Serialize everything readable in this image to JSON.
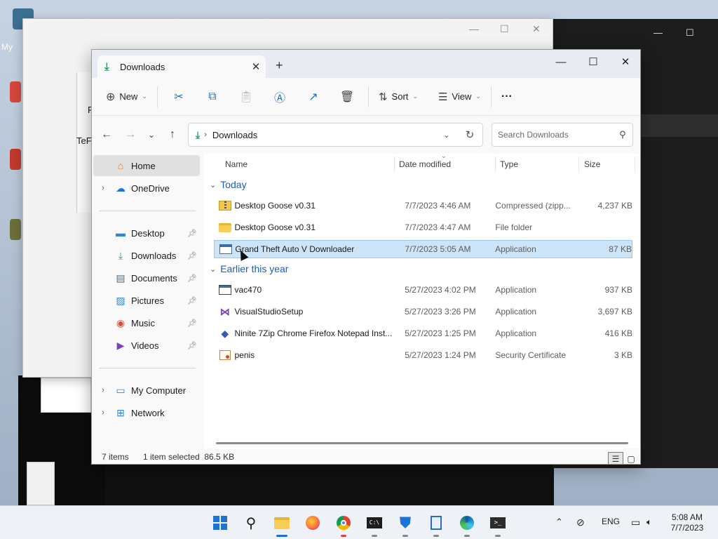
{
  "desktop": {
    "bg_window_controls": [
      "—",
      "☐",
      "✕"
    ],
    "dark_window_controls": [
      "—",
      "☐"
    ],
    "fragment_my": "My",
    "fragment_te": "TeF",
    "fragment_f": "F"
  },
  "explorer": {
    "tab_title": "Downloads",
    "tab_close": "✕",
    "new_tab": "+",
    "window_controls": {
      "minimize": "—",
      "maximize": "☐",
      "close": "✕"
    },
    "toolbar": {
      "new_label": "New",
      "sort_label": "Sort",
      "view_label": "View",
      "more": "···"
    },
    "address": {
      "path": "Downloads",
      "search_placeholder": "Search Downloads"
    },
    "sidebar": {
      "home": "Home",
      "onedrive": "OneDrive",
      "pinned": [
        "Desktop",
        "Downloads",
        "Documents",
        "Pictures",
        "Music",
        "Videos"
      ],
      "my_computer": "My Computer",
      "network": "Network"
    },
    "columns": {
      "name": "Name",
      "date": "Date modified",
      "type": "Type",
      "size": "Size"
    },
    "groups": {
      "today": "Today",
      "earlier": "Earlier this year"
    },
    "files_today": [
      {
        "name": "Desktop Goose v0.31",
        "date": "7/7/2023 4:46 AM",
        "type": "Compressed (zipp...",
        "size": "4,237 KB",
        "icon": "zip"
      },
      {
        "name": "Desktop Goose v0.31",
        "date": "7/7/2023 4:47 AM",
        "type": "File folder",
        "size": "",
        "icon": "folder"
      },
      {
        "name": "Grand Theft Auto V Downloader",
        "date": "7/7/2023 5:05 AM",
        "type": "Application",
        "size": "87 KB",
        "icon": "app",
        "selected": true
      }
    ],
    "files_earlier": [
      {
        "name": "vac470",
        "date": "5/27/2023 4:02 PM",
        "type": "Application",
        "size": "937 KB",
        "icon": "app"
      },
      {
        "name": "VisualStudioSetup",
        "date": "5/27/2023 3:26 PM",
        "type": "Application",
        "size": "3,697 KB",
        "icon": "vs"
      },
      {
        "name": "Ninite 7Zip Chrome Firefox Notepad Inst...",
        "date": "5/27/2023 1:25 PM",
        "type": "Application",
        "size": "416 KB",
        "icon": "ninite"
      },
      {
        "name": "penis",
        "date": "5/27/2023 1:24 PM",
        "type": "Security Certificate",
        "size": "3 KB",
        "icon": "cert"
      }
    ],
    "status": {
      "items": "7 items",
      "selected": "1 item selected  86.5 KB"
    }
  },
  "taskbar": {
    "tray_lang": "ENG",
    "time": "5:08 AM",
    "date": "7/7/2023"
  },
  "colors": {
    "accent": "#1e6fd1",
    "selection": "#cce4f7",
    "group_header": "#1a5fb4",
    "downloads_icon": "#2b9d62"
  }
}
